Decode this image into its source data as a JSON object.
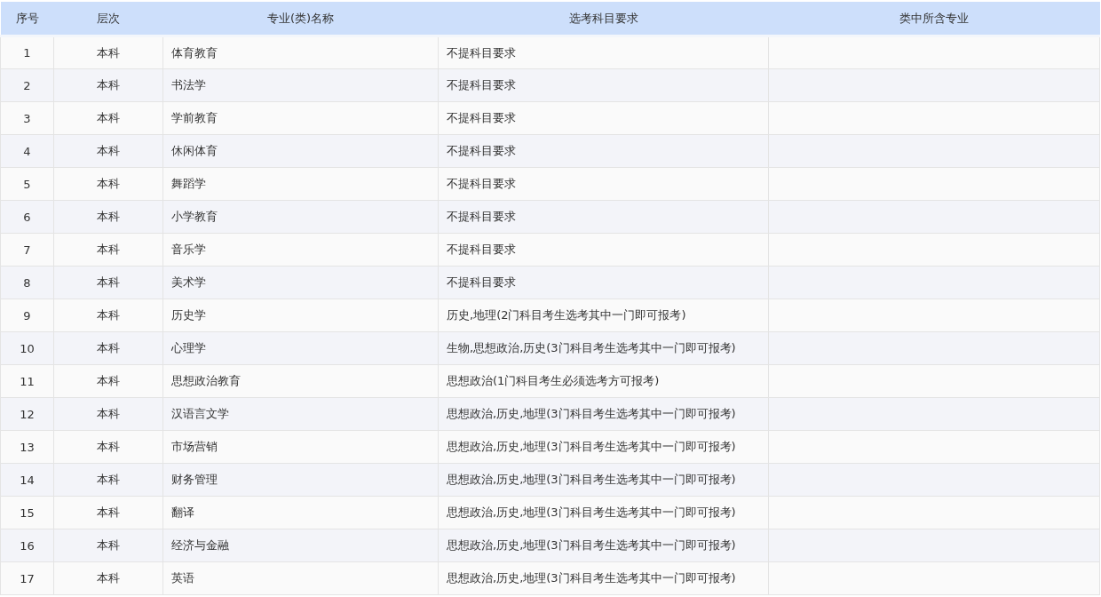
{
  "table": {
    "columns": [
      "序号",
      "层次",
      "专业(类)名称",
      "选考科目要求",
      "类中所含专业"
    ],
    "rows": [
      [
        "1",
        "本科",
        "体育教育",
        "不提科目要求"
      ],
      [
        "2",
        "本科",
        "书法学",
        "不提科目要求"
      ],
      [
        "3",
        "本科",
        "学前教育",
        "不提科目要求"
      ],
      [
        "4",
        "本科",
        "休闲体育",
        "不提科目要求"
      ],
      [
        "5",
        "本科",
        "舞蹈学",
        "不提科目要求"
      ],
      [
        "6",
        "本科",
        "小学教育",
        "不提科目要求"
      ],
      [
        "7",
        "本科",
        "音乐学",
        "不提科目要求"
      ],
      [
        "8",
        "本科",
        "美术学",
        "不提科目要求"
      ],
      [
        "9",
        "本科",
        "历史学",
        "历史,地理(2门科目考生选考其中一门即可报考)"
      ],
      [
        "10",
        "本科",
        "心理学",
        "生物,思想政治,历史(3门科目考生选考其中一门即可报考)"
      ],
      [
        "11",
        "本科",
        "思想政治教育",
        "思想政治(1门科目考生必须选考方可报考)"
      ],
      [
        "12",
        "本科",
        "汉语言文学",
        "思想政治,历史,地理(3门科目考生选考其中一门即可报考)"
      ],
      [
        "13",
        "本科",
        "市场营销",
        "思想政治,历史,地理(3门科目考生选考其中一门即可报考)"
      ],
      [
        "14",
        "本科",
        "财务管理",
        "思想政治,历史,地理(3门科目考生选考其中一门即可报考)"
      ],
      [
        "15",
        "本科",
        "翻译",
        "思想政治,历史,地理(3门科目考生选考其中一门即可报考)"
      ],
      [
        "16",
        "本科",
        "经济与金融",
        "思想政治,历史,地理(3门科目考生选考其中一门即可报考)"
      ],
      [
        "17",
        "本科",
        "英语",
        "思想政治,历史,地理(3门科目考生选考其中一门即可报考)"
      ]
    ]
  }
}
